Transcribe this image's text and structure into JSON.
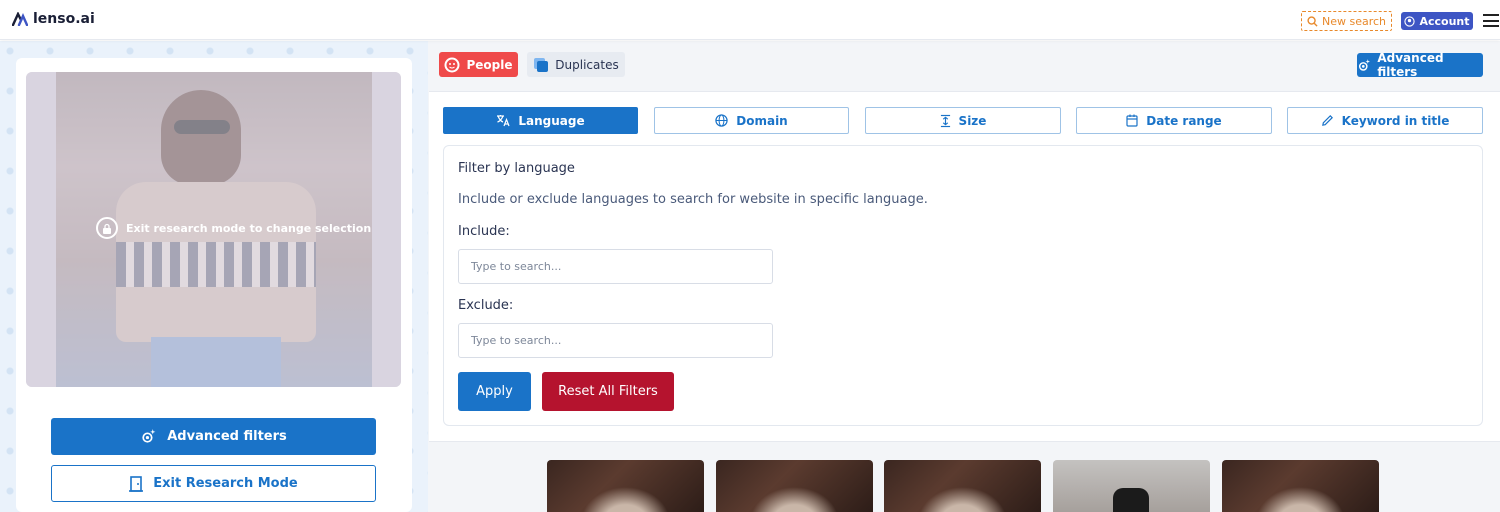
{
  "header": {
    "logo_text": "lenso.ai",
    "new_search": "New search",
    "account": "Account"
  },
  "left": {
    "overlay_message": "Exit research mode to change selection",
    "advanced_filters": "Advanced filters",
    "exit_research_mode": "Exit Research Mode"
  },
  "tabs": [
    {
      "label": "People",
      "active": true,
      "color": "#ef4a4a"
    },
    {
      "label": "Duplicates",
      "active": false
    }
  ],
  "top_advanced_filters": "Advanced filters",
  "filter_tabs": [
    {
      "label": "Language",
      "icon": "language-icon",
      "active": true
    },
    {
      "label": "Domain",
      "icon": "globe-icon",
      "active": false
    },
    {
      "label": "Size",
      "icon": "size-icon",
      "active": false
    },
    {
      "label": "Date range",
      "icon": "calendar-icon",
      "active": false
    },
    {
      "label": "Keyword in title",
      "icon": "pencil-icon",
      "active": false
    }
  ],
  "language_filter": {
    "title": "Filter by language",
    "description": "Include or exclude languages to search for website in specific language.",
    "include_label": "Include:",
    "include_placeholder": "Type to search...",
    "exclude_label": "Exclude:",
    "exclude_placeholder": "Type to search...",
    "apply": "Apply",
    "reset": "Reset All Filters"
  },
  "colors": {
    "primary": "#1a73c8",
    "danger": "#b5132e",
    "accent_orange": "#e8892b",
    "account": "#3d55c4"
  }
}
